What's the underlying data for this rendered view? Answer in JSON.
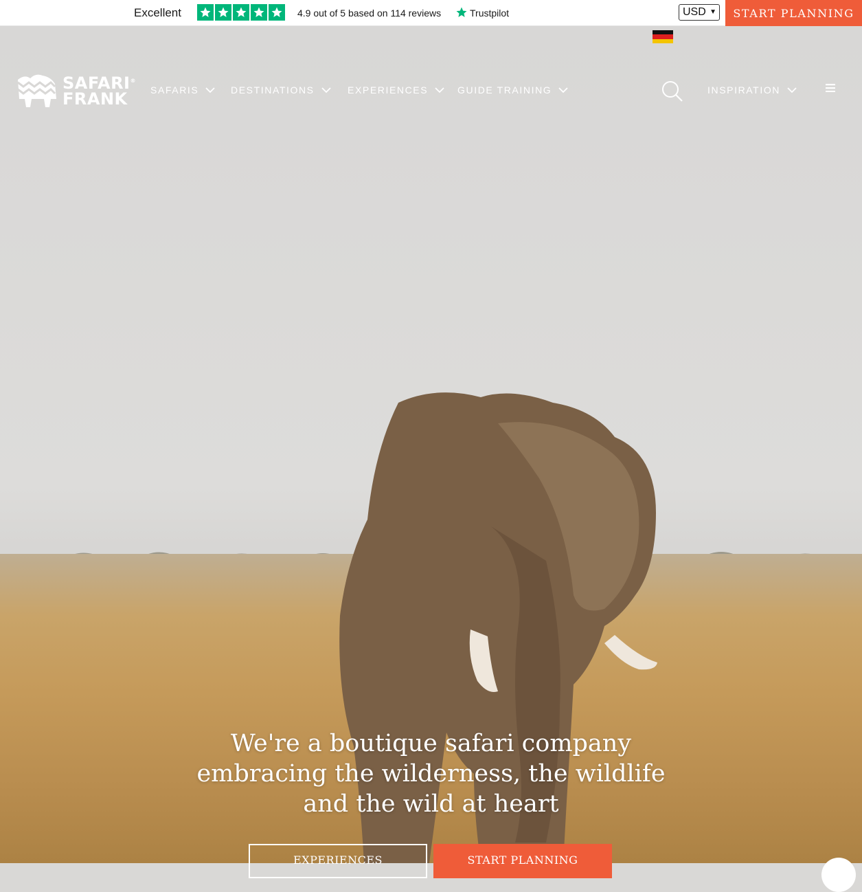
{
  "trustbar": {
    "rating_word": "Excellent",
    "score_text": "4.9 out of 5 based on 114 reviews",
    "stars": 5,
    "brand": "Trustpilot",
    "star_color": "#00b67a"
  },
  "currency": {
    "selected": "USD"
  },
  "header": {
    "start_planning": "START PLANNING",
    "accent": "#ef5c39",
    "logo": {
      "line1": "SAFARI",
      "line2": "FRANK",
      "mark": "®"
    },
    "nav": [
      {
        "label": "SAFARIS"
      },
      {
        "label": "DESTINATIONS"
      },
      {
        "label": "EXPERIENCES"
      },
      {
        "label": "GUIDE TRAINING"
      },
      {
        "label": "INSPIRATION"
      }
    ],
    "icons": [
      "germany-flag-icon",
      "search-icon",
      "menu-icon"
    ]
  },
  "hero": {
    "headline": "We're a boutique safari company embracing the wilderness, the wildlife and the wild at heart",
    "buttons": {
      "experiences": "EXPERIENCES",
      "start_planning": "START PLANNING"
    }
  }
}
